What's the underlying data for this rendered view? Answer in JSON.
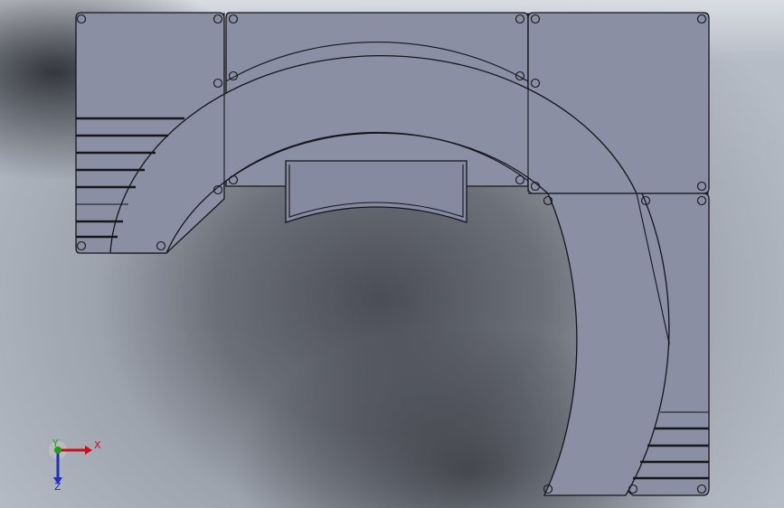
{
  "viewport": {
    "type": "cad-3d-view",
    "background": "gradient-gray"
  },
  "triad": {
    "x_label": "X",
    "y_label": "Y",
    "z_label": "Z",
    "x_color": "#c8101a",
    "y_color": "#1aa31a",
    "z_color": "#2230b8"
  },
  "model": {
    "plate_color": "#8a8fa3",
    "edge_color": "#15161a"
  }
}
